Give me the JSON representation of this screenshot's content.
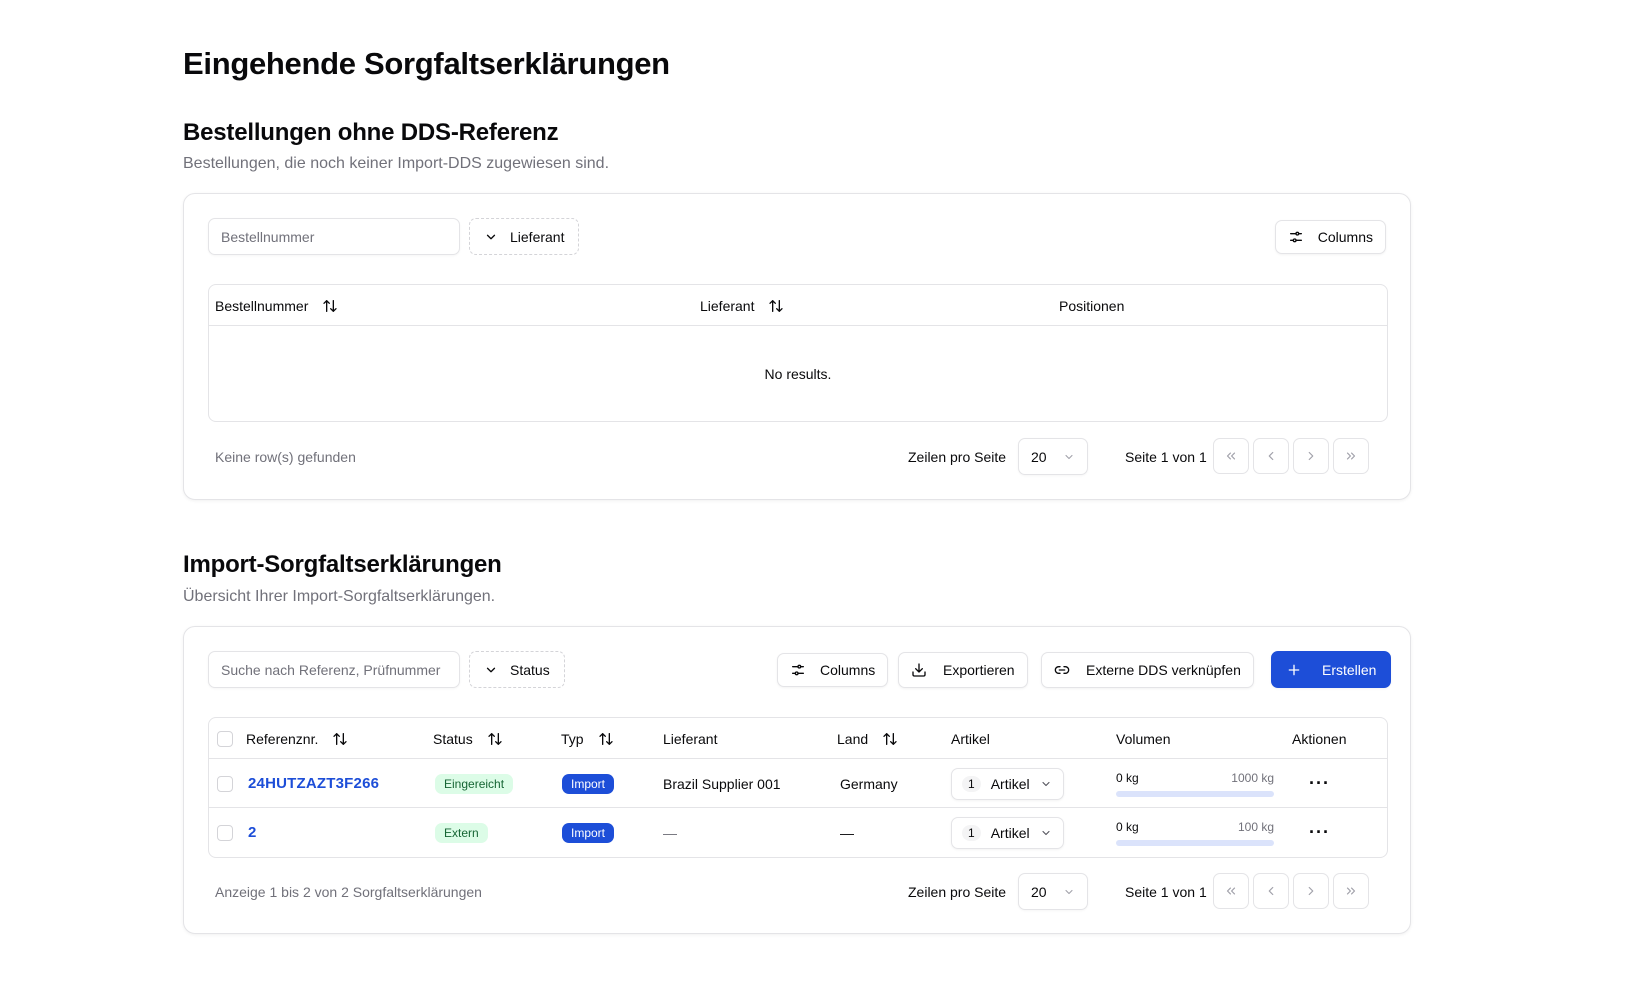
{
  "page_title": "Eingehende Sorgfaltserklärungen",
  "section1": {
    "title": "Bestellungen ohne DDS-Referenz",
    "description": "Bestellungen, die noch keiner Import-DDS zugewiesen sind.",
    "search_placeholder": "Bestellnummer",
    "filter_label": "Lieferant",
    "columns_label": "Columns",
    "headers": [
      "Bestellnummer",
      "Lieferant",
      "Positionen"
    ],
    "empty_text": "No results.",
    "footer_info": "Keine row(s) gefunden",
    "rows_per_page_label": "Zeilen pro Seite",
    "rows_per_page_value": "20",
    "page_info": "Seite 1 von 1"
  },
  "section2": {
    "title": "Import-Sorgfaltserklärungen",
    "description": "Übersicht Ihrer Import-Sorgfaltserklärungen.",
    "search_placeholder": "Suche nach Referenz, Prüfnummer",
    "filter_label": "Status",
    "columns_label": "Columns",
    "export_label": "Exportieren",
    "link_label": "Externe DDS verknüpfen",
    "create_label": "Erstellen",
    "headers": [
      "Referenznr.",
      "Status",
      "Typ",
      "Lieferant",
      "Land",
      "Artikel",
      "Volumen",
      "Aktionen"
    ],
    "rows": [
      {
        "ref": "24HUTZAZT3F266",
        "status": "Eingereicht",
        "type": "Import",
        "supplier": "Brazil Supplier 001",
        "country": "Germany",
        "article_count": "1",
        "article_label": "Artikel",
        "vol_current": "0 kg",
        "vol_max": "1000 kg",
        "vol_fraction": 0
      },
      {
        "ref": "2",
        "status": "Extern",
        "type": "Import",
        "supplier": "—",
        "country": "—",
        "article_count": "1",
        "article_label": "Artikel",
        "vol_current": "0 kg",
        "vol_max": "100 kg",
        "vol_fraction": 0
      }
    ],
    "footer_info": "Anzeige 1 bis 2 von 2 Sorgfaltserklärungen",
    "rows_per_page_label": "Zeilen pro Seite",
    "rows_per_page_value": "20",
    "page_info": "Seite 1 von 1"
  },
  "colors": {
    "primary": "#1d4ed8",
    "status_badge_bg": "#dcfce7",
    "status_badge_text": "#166534",
    "muted": "#71717a",
    "border": "#e4e4e7"
  },
  "icons": {
    "filter": "chevron-down-icon",
    "columns": "sliders-icon",
    "export": "download-icon",
    "link": "link-icon",
    "create": "plus-icon",
    "sort": "arrow-up-down-icon",
    "actions": "more-horizontal-icon"
  }
}
